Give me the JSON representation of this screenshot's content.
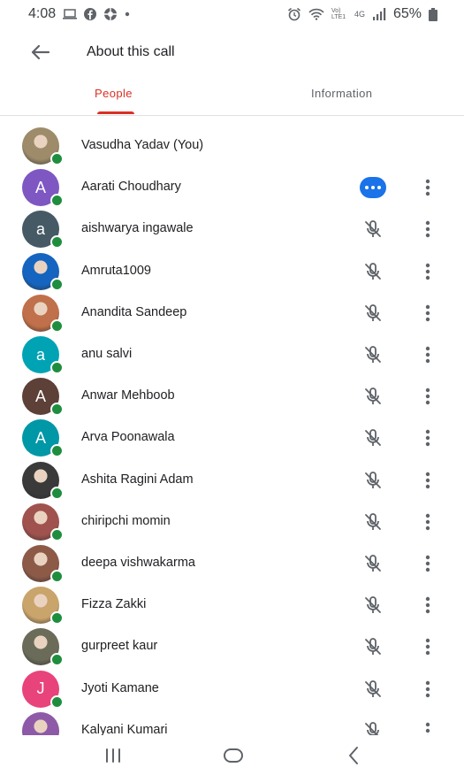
{
  "status_bar": {
    "time": "4:08",
    "left_icons": [
      "laptop-icon",
      "facebook-icon",
      "browser-icon",
      "dot-icon"
    ],
    "right_icons": [
      "alarm-icon",
      "wifi-icon",
      "volte-icon",
      "4g-icon",
      "signal-icon"
    ],
    "volte_label": "Vo) LTE1",
    "network_label": "4G",
    "battery": "65%"
  },
  "header": {
    "back_icon": "back-arrow-icon",
    "title": "About this call"
  },
  "tabs": [
    {
      "label": "People",
      "active": true
    },
    {
      "label": "Information",
      "active": false
    }
  ],
  "colors": {
    "accent_red": "#d93025",
    "online_green": "#1e8e3e",
    "speaking_blue": "#1a73e8"
  },
  "participants": [
    {
      "name": "Vasudha Yadav (You)",
      "avatar": "photo",
      "initial": "",
      "color": "#9e8b6a",
      "status": "self"
    },
    {
      "name": "Aarati Choudhary",
      "avatar": "letter",
      "initial": "A",
      "color": "#7e57c2",
      "status": "speaking"
    },
    {
      "name": "aishwarya ingawale",
      "avatar": "letter",
      "initial": "a",
      "color": "#455a64",
      "status": "muted"
    },
    {
      "name": "Amruta1009",
      "avatar": "photo",
      "initial": "",
      "color": "#1565c0",
      "status": "muted"
    },
    {
      "name": "Anandita Sandeep",
      "avatar": "photo",
      "initial": "",
      "color": "#c0704a",
      "status": "muted"
    },
    {
      "name": "anu salvi",
      "avatar": "letter",
      "initial": "a",
      "color": "#00a3b4",
      "status": "muted"
    },
    {
      "name": "Anwar Mehboob",
      "avatar": "letter",
      "initial": "A",
      "color": "#5d4037",
      "status": "muted"
    },
    {
      "name": "Arva Poonawala",
      "avatar": "letter",
      "initial": "A",
      "color": "#0097a7",
      "status": "muted"
    },
    {
      "name": "Ashita Ragini Adam",
      "avatar": "photo",
      "initial": "",
      "color": "#3a3a3a",
      "status": "muted"
    },
    {
      "name": "chiripchi momin",
      "avatar": "photo",
      "initial": "",
      "color": "#a0524f",
      "status": "muted"
    },
    {
      "name": "deepa vishwakarma",
      "avatar": "photo",
      "initial": "",
      "color": "#8d5a48",
      "status": "muted"
    },
    {
      "name": "Fizza Zakki",
      "avatar": "photo",
      "initial": "",
      "color": "#c9a46b",
      "status": "muted"
    },
    {
      "name": "gurpreet kaur",
      "avatar": "photo",
      "initial": "",
      "color": "#6b6b5a",
      "status": "muted"
    },
    {
      "name": "Jyoti Kamane",
      "avatar": "letter",
      "initial": "J",
      "color": "#e8437a",
      "status": "muted"
    },
    {
      "name": "Kalyani Kumari",
      "avatar": "photo",
      "initial": "",
      "color": "#8e5aa8",
      "status": "muted"
    }
  ],
  "nav_bar": {
    "icons": [
      "recent-apps-icon",
      "home-icon",
      "back-icon"
    ]
  }
}
